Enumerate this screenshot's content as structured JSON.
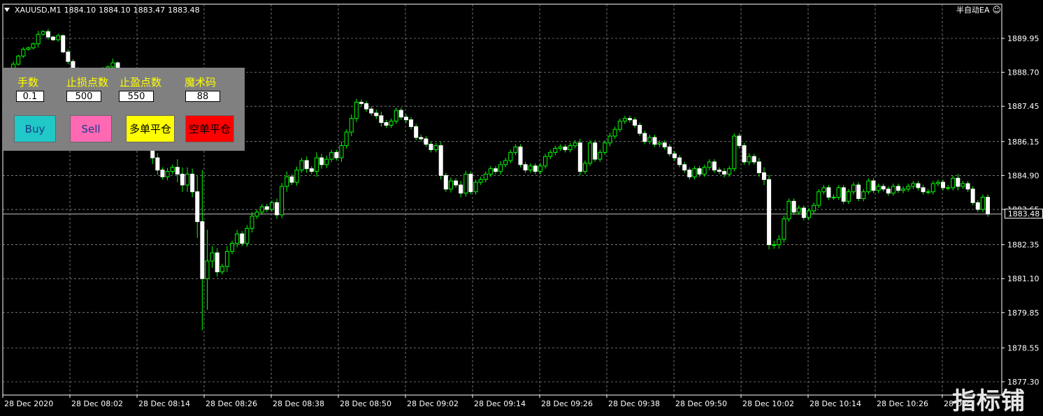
{
  "header": {
    "symbol": "XAUUSD,M1",
    "open": "1884.10",
    "high": "1884.10",
    "low": "1883.47",
    "close": "1883.48"
  },
  "ea_label": "半自动EA",
  "current_price": "1883.48",
  "panel": {
    "lots_label": "手数",
    "sl_label": "止损点数",
    "tp_label": "止盈点数",
    "magic_label": "魔术码",
    "lots_value": "0.1",
    "sl_value": "500",
    "tp_value": "550",
    "magic_value": "88",
    "buy_label": "Buy",
    "sell_label": "Sell",
    "close_long_label": "多单平仓",
    "close_short_label": "空单平仓"
  },
  "colors": {
    "background": "#000000",
    "grid": "#c0c0c0",
    "candle": "#ffffff",
    "wick": "#00ff00",
    "buy": "#20c8c8",
    "sell": "#ff69b4",
    "close_long": "#ffff00",
    "close_short": "#ff0000"
  },
  "watermark": "指标铺",
  "chart_data": {
    "type": "candlestick",
    "y_ticks": [
      "1889.95",
      "1888.70",
      "1887.45",
      "1886.15",
      "1884.90",
      "1883.65",
      "1882.35",
      "1881.10",
      "1879.85",
      "1878.55",
      "1877.30"
    ],
    "x_ticks": [
      "28 Dec 2020",
      "28 Dec 08:02",
      "28 Dec 08:14",
      "28 Dec 08:26",
      "28 Dec 08:38",
      "28 Dec 08:50",
      "28 Dec 09:02",
      "28 Dec 09:14",
      "28 Dec 09:26",
      "28 Dec 09:38",
      "28 Dec 09:50",
      "28 Dec 10:02",
      "28 Dec 10:14",
      "28 Dec 10:26",
      "28 Dec"
    ],
    "ylim": [
      1877.2,
      1890.9
    ],
    "grid": true,
    "closes": [
      1888.55,
      1889.0,
      1889.3,
      1889.55,
      1889.6,
      1889.75,
      1890.1,
      1890.2,
      1890.0,
      1889.9,
      1890.05,
      1889.45,
      1889.1,
      1888.85,
      1888.5,
      1888.2,
      1888.0,
      1888.4,
      1888.7,
      1888.85,
      1888.9,
      1889.05,
      1888.6,
      1888.1,
      1887.8,
      1887.45,
      1887.0,
      1886.5,
      1886.0,
      1885.55,
      1885.1,
      1884.85,
      1885.05,
      1885.2,
      1884.95,
      1884.55,
      1884.95,
      1884.3,
      1883.2,
      1881.1,
      1881.75,
      1882.05,
      1881.35,
      1881.55,
      1882.1,
      1882.4,
      1882.75,
      1882.4,
      1882.95,
      1883.4,
      1883.55,
      1883.75,
      1883.65,
      1883.9,
      1883.45,
      1884.5,
      1884.85,
      1884.65,
      1885.1,
      1885.45,
      1885.15,
      1885.05,
      1885.55,
      1885.3,
      1885.5,
      1885.75,
      1885.55,
      1886.0,
      1886.5,
      1887.0,
      1887.6,
      1887.55,
      1887.35,
      1887.2,
      1887.1,
      1886.85,
      1886.75,
      1886.9,
      1887.3,
      1887.05,
      1886.95,
      1886.7,
      1886.3,
      1886.25,
      1886.05,
      1885.85,
      1886.0,
      1884.9,
      1884.4,
      1884.7,
      1884.55,
      1884.25,
      1884.95,
      1884.3,
      1884.65,
      1884.75,
      1884.95,
      1885.15,
      1885.05,
      1885.3,
      1885.45,
      1885.75,
      1885.95,
      1885.3,
      1885.1,
      1885.25,
      1885.05,
      1885.25,
      1885.6,
      1885.75,
      1885.9,
      1885.95,
      1885.85,
      1886.0,
      1886.1,
      1885.05,
      1885.35,
      1886.1,
      1885.5,
      1885.75,
      1886.1,
      1886.35,
      1886.6,
      1886.9,
      1887.0,
      1886.95,
      1886.75,
      1886.45,
      1886.15,
      1886.3,
      1886.05,
      1886.1,
      1885.95,
      1885.7,
      1885.55,
      1885.3,
      1885.1,
      1884.85,
      1885.15,
      1884.95,
      1885.2,
      1885.4,
      1885.1,
      1885.05,
      1884.95,
      1885.15,
      1886.35,
      1886.0,
      1885.4,
      1885.6,
      1885.4,
      1885.0,
      1884.75,
      1882.35,
      1882.35,
      1882.55,
      1883.3,
      1883.95,
      1883.55,
      1883.7,
      1883.35,
      1883.6,
      1883.8,
      1884.3,
      1884.45,
      1884.1,
      1884.1,
      1884.45,
      1883.95,
      1884.3,
      1884.55,
      1884.05,
      1884.3,
      1884.7,
      1884.35,
      1884.5,
      1884.4,
      1884.25,
      1884.5,
      1884.35,
      1884.4,
      1884.5,
      1884.6,
      1884.45,
      1884.3,
      1884.3,
      1884.6,
      1884.65,
      1884.45,
      1884.45,
      1884.8,
      1884.5,
      1884.6,
      1884.4,
      1883.9,
      1883.65,
      1884.1,
      1883.48
    ],
    "opens_shift": 1,
    "wick_extra": [
      0.12,
      0.2,
      0.1,
      0.15,
      0.1,
      0.1,
      0.25,
      0.1,
      0.2,
      0.1,
      0.15,
      0.1,
      0.2,
      0.15,
      0.1,
      0.1,
      0.2,
      0.2,
      0.15,
      0.1,
      0.1,
      0.3,
      0.1,
      0.2,
      0.15,
      0.1,
      0.1,
      0.15,
      0.3,
      0.45,
      0.35,
      0.2,
      0.25,
      0.2,
      0.6,
      0.5,
      0.5,
      0.4,
      1.2,
      3.8,
      2.3,
      0.5,
      0.35,
      0.2,
      0.4,
      0.2,
      0.3,
      0.2,
      0.25,
      0.3,
      0.2,
      0.2,
      0.2,
      0.15,
      0.3,
      0.25,
      0.4,
      0.2,
      0.25,
      0.2,
      0.3,
      0.2,
      0.4,
      0.3,
      0.25,
      0.2,
      0.2,
      0.3,
      0.2,
      0.3,
      0.25,
      0.2,
      0.2,
      0.2,
      0.25,
      0.3,
      0.2,
      0.2,
      0.2,
      0.2,
      0.2,
      0.2,
      0.2,
      0.2,
      0.2,
      0.2,
      0.2,
      0.3,
      0.2,
      0.25,
      0.2,
      0.3,
      0.25,
      0.2,
      0.2,
      0.2,
      0.2,
      0.2,
      0.2,
      0.25,
      0.2,
      0.2,
      0.2,
      0.2,
      0.2,
      0.2,
      0.2,
      0.2,
      0.2,
      0.2,
      0.2,
      0.2,
      0.2,
      0.2,
      0.2,
      0.3,
      0.2,
      0.2,
      0.2,
      0.2,
      0.2,
      0.25,
      0.2,
      0.2,
      0.2,
      0.2,
      0.2,
      0.2,
      0.2,
      0.2,
      0.2,
      0.2,
      0.2,
      0.2,
      0.2,
      0.2,
      0.2,
      0.2,
      0.2,
      0.2,
      0.2,
      0.2,
      0.2,
      0.2,
      0.25,
      0.2,
      0.2,
      0.2,
      0.2,
      0.25,
      0.2,
      0.3,
      0.4,
      0.35,
      0.3,
      0.3,
      0.25,
      0.2,
      0.2,
      0.2,
      0.2,
      0.2,
      0.2,
      0.2,
      0.2,
      0.2,
      0.2,
      0.2,
      0.2,
      0.2,
      0.2,
      0.2,
      0.2,
      0.2,
      0.2,
      0.2,
      0.2,
      0.2,
      0.2,
      0.2,
      0.2,
      0.2,
      0.2,
      0.2,
      0.2,
      0.2,
      0.2,
      0.2,
      0.2,
      0.2,
      0.2,
      0.3,
      0.2,
      0.2,
      0.2,
      0.2,
      0.2,
      0.2,
      0.2,
      0.2
    ]
  }
}
